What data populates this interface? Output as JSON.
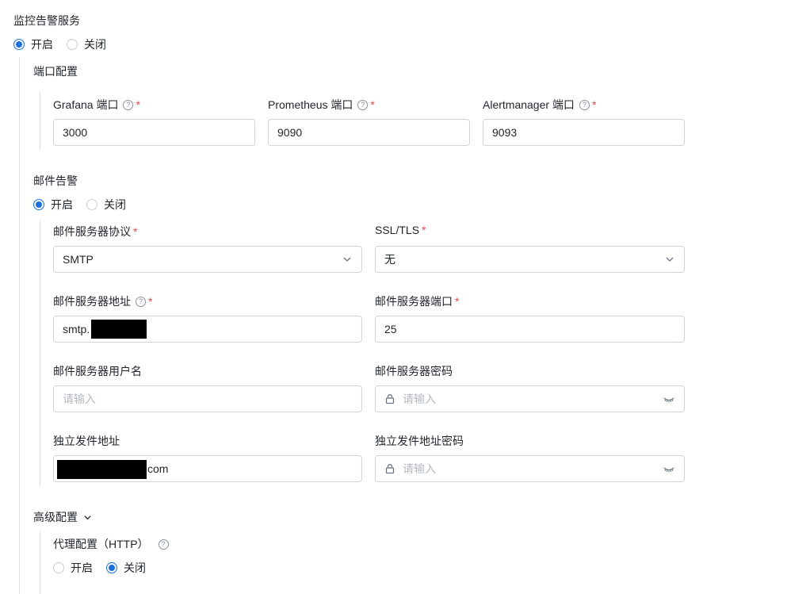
{
  "monitor": {
    "title": "监控告警服务",
    "on_label": "开启",
    "off_label": "关闭",
    "ports": {
      "title": "端口配置",
      "grafana": {
        "label": "Grafana 端口",
        "value": "3000"
      },
      "prometheus": {
        "label": "Prometheus 端口",
        "value": "9090"
      },
      "alertmanager": {
        "label": "Alertmanager 端口",
        "value": "9093"
      }
    },
    "mail": {
      "title": "邮件告警",
      "on_label": "开启",
      "off_label": "关闭",
      "protocol": {
        "label": "邮件服务器协议",
        "value": "SMTP"
      },
      "ssl": {
        "label": "SSL/TLS",
        "value": "无"
      },
      "address": {
        "label": "邮件服务器地址",
        "value": "smtp."
      },
      "port": {
        "label": "邮件服务器端口",
        "value": "25"
      },
      "username": {
        "label": "邮件服务器用户名",
        "placeholder": "请输入"
      },
      "password": {
        "label": "邮件服务器密码",
        "placeholder": "请输入"
      },
      "sender": {
        "label": "独立发件地址",
        "value_suffix": "com"
      },
      "sender_password": {
        "label": "独立发件地址密码",
        "placeholder": "请输入"
      }
    },
    "advanced": {
      "title": "高级配置",
      "proxy": {
        "label": "代理配置（HTTP）",
        "on_label": "开启",
        "off_label": "关闭"
      }
    }
  },
  "colors": {
    "accent": "#1d6fe0",
    "required": "#e5484d",
    "border": "#d0d4da"
  },
  "icons": {
    "help": "question-circle-icon",
    "caret": "chevron-down-icon",
    "lock": "lock-icon",
    "eye": "eye-closed-icon"
  }
}
